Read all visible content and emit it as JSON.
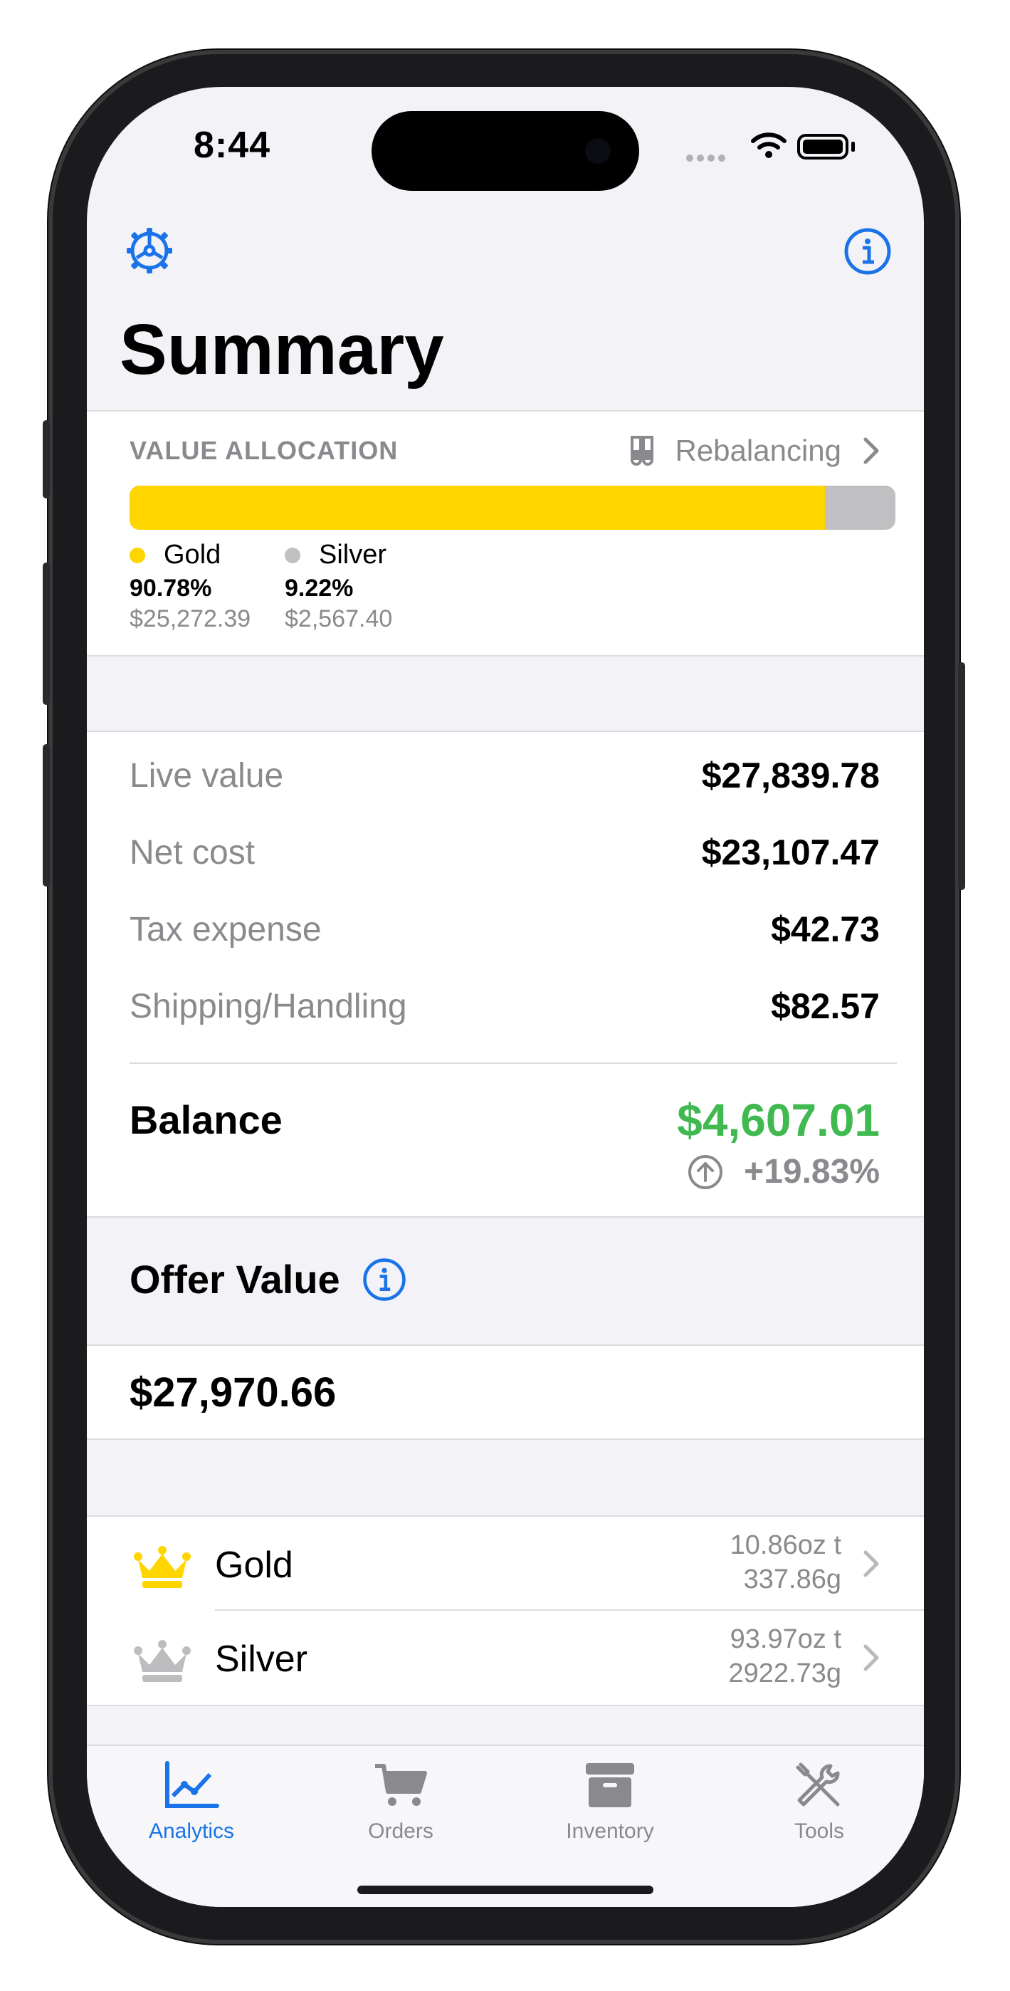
{
  "status_bar": {
    "time": "8:44"
  },
  "header": {
    "title": "Summary"
  },
  "allocation": {
    "section_label": "VALUE ALLOCATION",
    "rebalancing_label": "Rebalancing",
    "segments": [
      {
        "name": "Gold",
        "percent": "90.78%",
        "value": "$25,272.39",
        "fraction": 0.9078,
        "color": "#FFD500"
      },
      {
        "name": "Silver",
        "percent": "9.22%",
        "value": "$2,567.40",
        "fraction": 0.0922,
        "color": "#C0C0C2"
      }
    ]
  },
  "totals": {
    "live_value_label": "Live value",
    "live_value": "$27,839.78",
    "net_cost_label": "Net cost",
    "net_cost": "$23,107.47",
    "tax_label": "Tax expense",
    "tax": "$42.73",
    "shipping_label": "Shipping/Handling",
    "shipping": "$82.57",
    "balance_label": "Balance",
    "balance": "$4,607.01",
    "balance_pct": "+19.83%",
    "balance_color": "#3FB950"
  },
  "offer": {
    "title": "Offer Value",
    "value": "$27,970.66"
  },
  "metals": [
    {
      "name": "Gold",
      "oz": "10.86oz t",
      "grams": "337.86g",
      "icon": "crown-icon",
      "color": "#FFD500"
    },
    {
      "name": "Silver",
      "oz": "93.97oz t",
      "grams": "2922.73g",
      "icon": "crown-icon",
      "color": "#BDBDC0"
    }
  ],
  "tabbar": {
    "tabs": [
      {
        "label": "Analytics",
        "icon": "chart-line-icon",
        "active": true
      },
      {
        "label": "Orders",
        "icon": "cart-icon",
        "active": false
      },
      {
        "label": "Inventory",
        "icon": "archive-box-icon",
        "active": false
      },
      {
        "label": "Tools",
        "icon": "tools-icon",
        "active": false
      }
    ]
  },
  "colors": {
    "accent": "#1A73E8",
    "gold": "#FFD500",
    "silver": "#C0C0C2",
    "positive": "#3FB950"
  }
}
